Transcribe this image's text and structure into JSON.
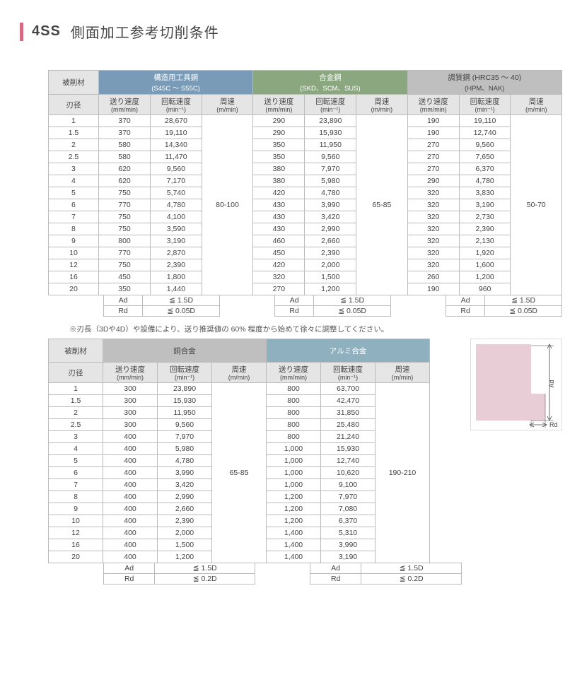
{
  "title": {
    "code": "4SS",
    "text": "側面加工参考切削条件"
  },
  "labels": {
    "work_material": "被削材",
    "blade_dia": "刃径",
    "feed": "送り速度",
    "feed_unit": "(mm/min)",
    "spin": "回転速度",
    "spin_unit": "(min⁻¹)",
    "speed": "周速",
    "speed_unit": "(m/min)",
    "ad": "Ad",
    "rd": "Rd",
    "note": "※刃長（3Dや4D）や設備により、送り推奨値の 60% 程度から始めて徐々に調整してください。"
  },
  "groups_top": [
    {
      "name": "構造用工具鋼",
      "sub": "(S45C ～ S55C)",
      "cls": "g-steel"
    },
    {
      "name": "合金鋼",
      "sub": "(SKD、SCM、SUS)",
      "cls": "g-alloy"
    },
    {
      "name": "調質鋼 (HRC35 ～ 40)",
      "sub": "(HPM、NAK)",
      "cls": "g-hard"
    }
  ],
  "groups_bot": [
    {
      "name": "銅合金",
      "sub": "",
      "cls": "g-copper"
    },
    {
      "name": "アルミ合金",
      "sub": "",
      "cls": "g-alu"
    }
  ],
  "diameters": [
    "1",
    "1.5",
    "2",
    "2.5",
    "3",
    "4",
    "5",
    "6",
    "7",
    "8",
    "9",
    "10",
    "12",
    "16",
    "20"
  ],
  "top": {
    "steel": {
      "feed": [
        "370",
        "370",
        "580",
        "580",
        "620",
        "620",
        "750",
        "770",
        "750",
        "750",
        "800",
        "770",
        "750",
        "450",
        "350"
      ],
      "spin": [
        "28,670",
        "19,110",
        "14,340",
        "11,470",
        "9,560",
        "7,170",
        "5,740",
        "4,780",
        "4,100",
        "3,590",
        "3,190",
        "2,870",
        "2,390",
        "1,800",
        "1,440"
      ],
      "speed": "80-100"
    },
    "alloy": {
      "feed": [
        "290",
        "290",
        "350",
        "350",
        "380",
        "380",
        "420",
        "430",
        "430",
        "430",
        "460",
        "450",
        "420",
        "320",
        "270"
      ],
      "spin": [
        "23,890",
        "15,930",
        "11,950",
        "9,560",
        "7,970",
        "5,980",
        "4,780",
        "3,990",
        "3,420",
        "2,990",
        "2,660",
        "2,390",
        "2,000",
        "1,500",
        "1,200"
      ],
      "speed": "65-85"
    },
    "hard": {
      "feed": [
        "190",
        "190",
        "270",
        "270",
        "270",
        "290",
        "320",
        "320",
        "320",
        "320",
        "320",
        "320",
        "320",
        "260",
        "190"
      ],
      "spin": [
        "19,110",
        "12,740",
        "9,560",
        "7,650",
        "6,370",
        "4,780",
        "3,830",
        "3,190",
        "2,730",
        "2,390",
        "2,130",
        "1,920",
        "1,600",
        "1,200",
        "960"
      ],
      "speed": "50-70"
    }
  },
  "top_adrd": {
    "ad": "≦ 1.5D",
    "rd": "≦ 0.05D"
  },
  "bot": {
    "copper": {
      "feed": [
        "300",
        "300",
        "300",
        "300",
        "400",
        "400",
        "400",
        "400",
        "400",
        "400",
        "400",
        "400",
        "400",
        "400",
        "400"
      ],
      "spin": [
        "23,890",
        "15,930",
        "11,950",
        "9,560",
        "7,970",
        "5,980",
        "4,780",
        "3,990",
        "3,420",
        "2,990",
        "2,660",
        "2,390",
        "2,000",
        "1,500",
        "1,200"
      ],
      "speed": "65-85"
    },
    "alu": {
      "feed": [
        "800",
        "800",
        "800",
        "800",
        "800",
        "1,000",
        "1,000",
        "1,000",
        "1,000",
        "1,200",
        "1,200",
        "1,200",
        "1,400",
        "1,400",
        "1,400"
      ],
      "spin": [
        "63,700",
        "42,470",
        "31,850",
        "25,480",
        "21,240",
        "15,930",
        "12,740",
        "10,620",
        "9,100",
        "7,970",
        "7,080",
        "6,370",
        "5,310",
        "3,990",
        "3,190"
      ],
      "speed": "190-210"
    }
  },
  "bot_adrd": {
    "ad": "≦ 1.5D",
    "rd": "≦ 0.2D"
  },
  "diagram": {
    "ad_label": "Ad",
    "rd_label": "Rd"
  }
}
